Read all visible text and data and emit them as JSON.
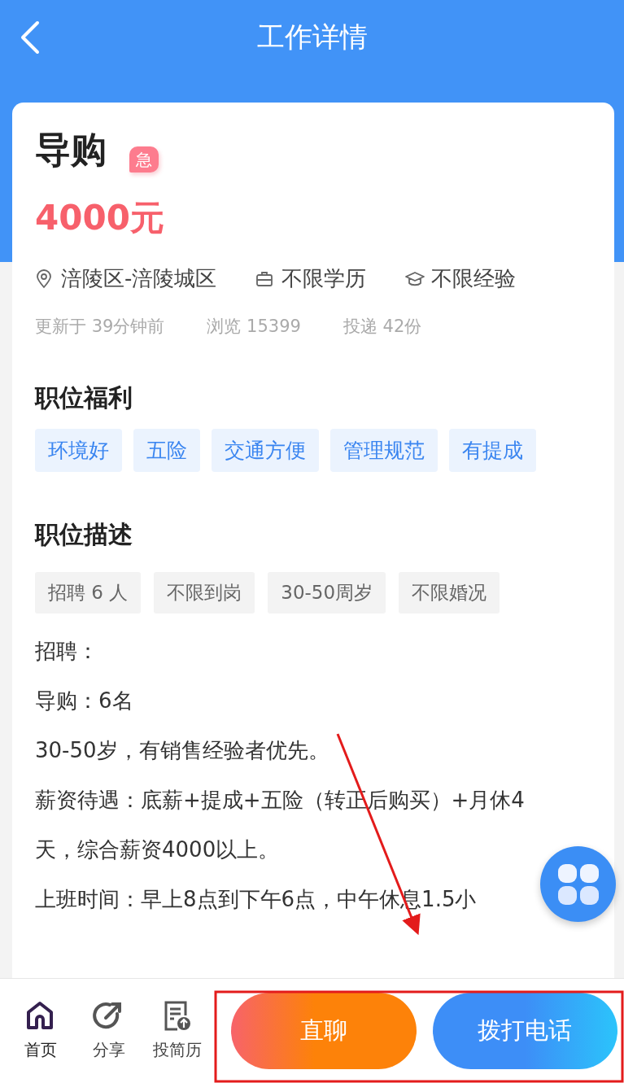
{
  "header": {
    "title": "工作详情"
  },
  "job": {
    "title": "导购",
    "urgent_badge": "急",
    "salary": "4000元",
    "facts": [
      {
        "kind": "location",
        "text": "涪陵区-涪陵城区"
      },
      {
        "kind": "education",
        "text": "不限学历"
      },
      {
        "kind": "experience",
        "text": "不限经验"
      }
    ],
    "stats": [
      "更新于 39分钟前",
      "浏览 15399",
      "投递 42份"
    ]
  },
  "benefits": {
    "heading": "职位福利",
    "tags": [
      "环境好",
      "五险",
      "交通方便",
      "管理规范",
      "有提成"
    ]
  },
  "description": {
    "heading": "职位描述",
    "tags": [
      "招聘 6 人",
      "不限到岗",
      "30-50周岁",
      "不限婚况"
    ],
    "lines": [
      "招聘：",
      "导购：6名",
      "30-50岁，有销售经验者优先。",
      "薪资待遇：底薪+提成+五险（转正后购买）+月休4天，综合薪资4000以上。",
      "上班时间：早上8点到下午6点，中午休息1.5小"
    ]
  },
  "bottom_nav": [
    {
      "kind": "home",
      "label": "首页",
      "selected": true
    },
    {
      "kind": "share",
      "label": "分享",
      "selected": false
    },
    {
      "kind": "resume",
      "label": "投简历",
      "selected": false
    }
  ],
  "actions": [
    {
      "kind": "chat",
      "label": "直聊"
    },
    {
      "kind": "call",
      "label": "拨打电话"
    }
  ]
}
